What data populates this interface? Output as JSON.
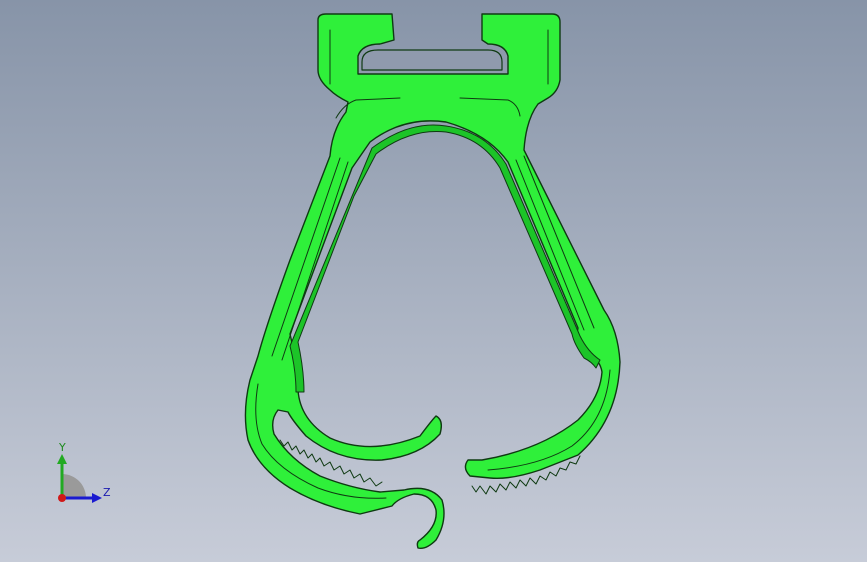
{
  "viewport": {
    "background_top": "#8794a8",
    "background_bottom": "#c7ccd8"
  },
  "model": {
    "fill_color": "#2ff03a",
    "edge_color": "#0f3a12",
    "shading_color": "#1cc428"
  },
  "triad": {
    "y_label": "Y",
    "z_label": "Z",
    "y_color": "#22aa22",
    "z_color": "#1a1ad0",
    "origin_color": "#d01818"
  }
}
